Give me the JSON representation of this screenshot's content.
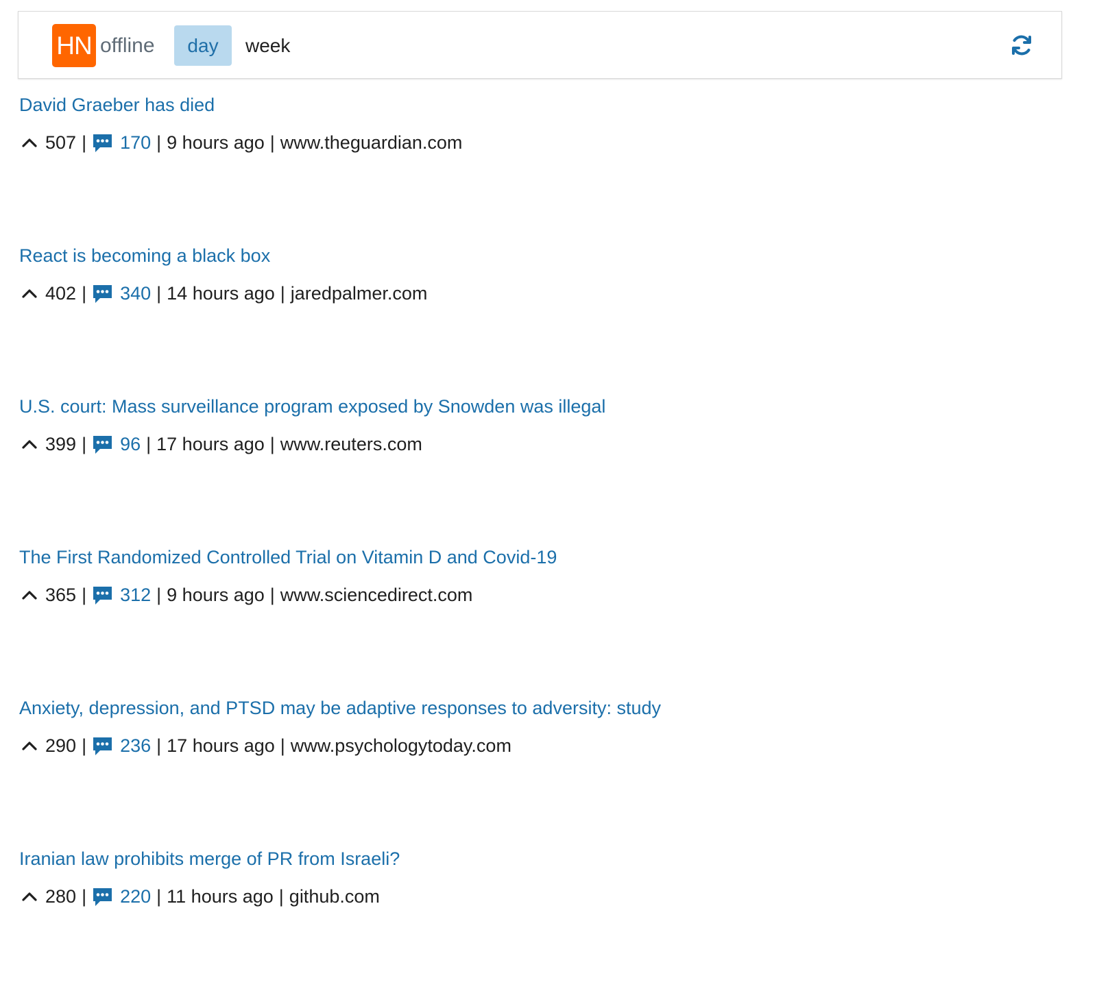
{
  "header": {
    "logo_text": "HN",
    "brand_text": "offline",
    "tabs": [
      {
        "label": "day",
        "active": true
      },
      {
        "label": "week",
        "active": false
      }
    ],
    "refresh_icon": "refresh-icon"
  },
  "colors": {
    "logo": "#ff6600",
    "link": "#1b6faa",
    "active_tab_bg": "#b9d9ee"
  },
  "stories": [
    {
      "title": "David Graeber has died",
      "points": "507",
      "comments": "170",
      "age": "9 hours ago",
      "domain": "www.theguardian.com"
    },
    {
      "title": "React is becoming a black box",
      "points": "402",
      "comments": "340",
      "age": "14 hours ago",
      "domain": "jaredpalmer.com"
    },
    {
      "title": "U.S. court: Mass surveillance program exposed by Snowden was illegal",
      "points": "399",
      "comments": "96",
      "age": "17 hours ago",
      "domain": "www.reuters.com"
    },
    {
      "title": "The First Randomized Controlled Trial on Vitamin D and Covid-19",
      "points": "365",
      "comments": "312",
      "age": "9 hours ago",
      "domain": "www.sciencedirect.com"
    },
    {
      "title": "Anxiety, depression, and PTSD may be adaptive responses to adversity: study",
      "points": "290",
      "comments": "236",
      "age": "17 hours ago",
      "domain": "www.psychologytoday.com"
    },
    {
      "title": "Iranian law prohibits merge of PR from Israeli?",
      "points": "280",
      "comments": "220",
      "age": "11 hours ago",
      "domain": "github.com"
    }
  ],
  "meta": {
    "separator": "|"
  }
}
